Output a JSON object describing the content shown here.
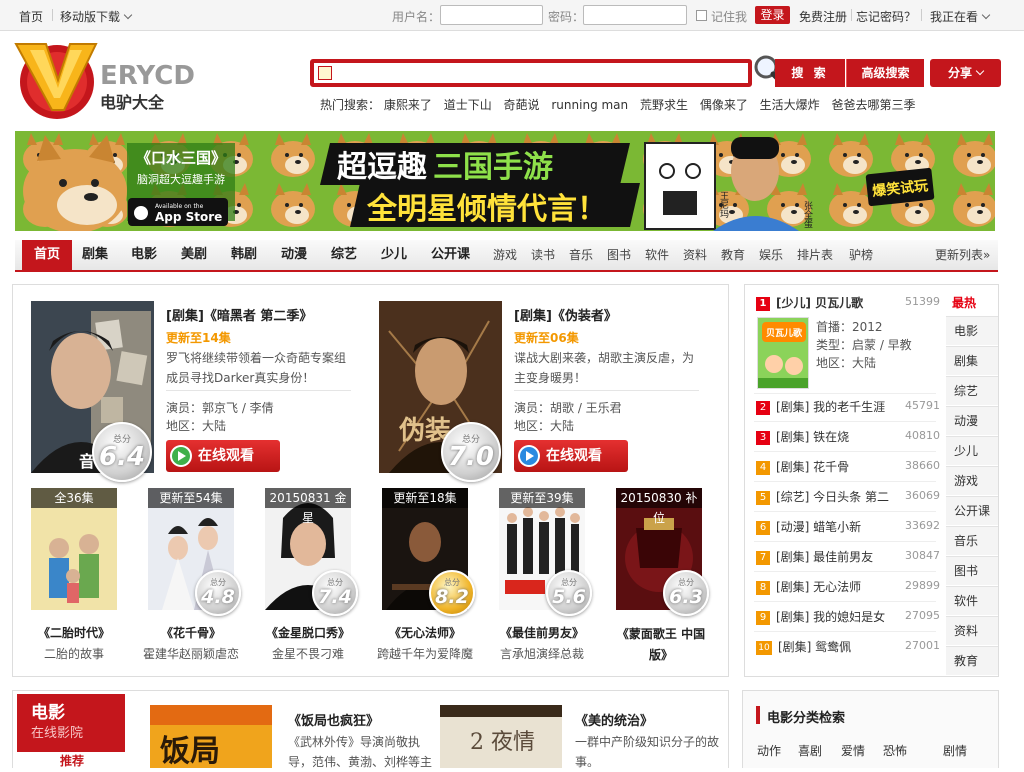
{
  "topbar": {
    "home": "首页",
    "mobile": "移动版下载",
    "user_label": "用户名：",
    "pwd_label": "密码：",
    "remember": "记住我",
    "login": "登录",
    "register": "免费注册",
    "forgot": "忘记密码？",
    "watching": "我正在看"
  },
  "logo": {
    "brand": "ERYCD",
    "cn": "电驴大全",
    "v": "V"
  },
  "search": {
    "button": "搜 索",
    "advanced": "高级搜索",
    "share": "分享",
    "hot_label": "热门搜索：",
    "hot": [
      "康熙来了",
      "道士下山",
      "奇葩说",
      "running man",
      "荒野求生",
      "偶像来了",
      "生活大爆炸",
      "爸爸去哪第三季"
    ]
  },
  "banner": {
    "game": "《口水三国》",
    "tagline": "脑洞超大逗趣手游",
    "appstore_small": "Available on the",
    "appstore": "App Store",
    "headline1a": "超逗趣",
    "headline1b": "三国手游",
    "headline2": "全明星倾情代言！",
    "name1": "王尼玛",
    "name2": "张全蛋",
    "cta": "爆笑试玩"
  },
  "nav": {
    "main": [
      "首页",
      "剧集",
      "电影",
      "美剧",
      "韩剧",
      "动漫",
      "综艺",
      "少儿",
      "公开课"
    ],
    "sub": [
      "游戏",
      "读书",
      "音乐",
      "图书",
      "软件",
      "资料",
      "教育",
      "娱乐",
      "排片表",
      "驴榜"
    ],
    "more": "更新列表»"
  },
  "featured": [
    {
      "title": "[剧集]《暗黑者 第二季》",
      "update": "更新至14集",
      "desc": "罗飞将继续带领着一众奇葩专案组成员寻找Darker真实身份！",
      "actors": "演员：郭京飞 / 李倩",
      "region": "地区：大陆",
      "score": "6.4",
      "watch": "在线观看",
      "poster_text": "音"
    },
    {
      "title": "[剧集]《伪装者》",
      "update": "更新至06集",
      "desc": "谍战大剧来袭，胡歌主演反虐，为主变身暖男！",
      "actors": "演员：胡歌 / 王乐君",
      "region": "地区：大陆",
      "score": "7.0",
      "watch": "在线观看",
      "poster_text": "伪装"
    }
  ],
  "score_label": "总分",
  "thumbs": [
    {
      "tag": "全36集",
      "title": "《二胎时代》",
      "sub": "二胎的故事",
      "score": ""
    },
    {
      "tag": "更新至54集",
      "title": "《花千骨》",
      "sub": "霍建华赵丽颖虐恋",
      "score": "4.8"
    },
    {
      "tag": "20150831 金星",
      "title": "《金星脱口秀》",
      "sub": "金星不畏刁难",
      "score": "7.4"
    },
    {
      "tag": "更新至18集",
      "title": "《无心法师》",
      "sub": "跨越千年为爱降魔",
      "score": "8.2"
    },
    {
      "tag": "更新至39集",
      "title": "《最佳前男友》",
      "sub": "言承旭演绎总裁",
      "score": "5.6"
    },
    {
      "tag": "20150830 补位",
      "title": "《蒙面歌王 中国版》",
      "sub": "",
      "score": "6.3"
    }
  ],
  "rank": {
    "title": "[少儿] 贝瓦儿歌",
    "hot_tab": "最热",
    "top_count": "51399",
    "info": [
      "首播：2012",
      "类型：启蒙 / 早教",
      "地区：大陆"
    ],
    "items": [
      {
        "n": "2",
        "t": "[剧集] 我的老千生涯",
        "c": "45791"
      },
      {
        "n": "3",
        "t": "[剧集] 铁在烧",
        "c": "40810"
      },
      {
        "n": "4",
        "t": "[剧集] 花千骨",
        "c": "38660"
      },
      {
        "n": "5",
        "t": "[综艺] 今日头条 第二",
        "c": "36069"
      },
      {
        "n": "6",
        "t": "[动漫] 蜡笔小新",
        "c": "33692"
      },
      {
        "n": "7",
        "t": "[剧集] 最佳前男友",
        "c": "30847"
      },
      {
        "n": "8",
        "t": "[剧集] 无心法师",
        "c": "29899"
      },
      {
        "n": "9",
        "t": "[剧集] 我的媳妇是女",
        "c": "27095"
      },
      {
        "n": "10",
        "t": "[剧集] 鸳鸯佩",
        "c": "27001"
      }
    ],
    "categories": [
      "电影",
      "剧集",
      "综艺",
      "动漫",
      "少儿",
      "游戏",
      "公开课",
      "音乐",
      "图书",
      "软件",
      "资料",
      "教育"
    ],
    "thumb_text": "贝瓦儿歌"
  },
  "movie": {
    "tag": "电影",
    "tag_sub": "在线影院",
    "tag_btn": "推荐",
    "items": [
      {
        "title": "《饭局也疯狂》",
        "desc": "《武林外传》导演尚敬执导，范伟、黄渤、刘桦等主",
        "poster": "饭局"
      },
      {
        "title": "《美的统治》",
        "desc": "一群中产阶级知识分子的故事。",
        "poster": "2 夜情"
      }
    ]
  },
  "filter": {
    "title": "电影分类检索",
    "genres": [
      "动作",
      "喜剧",
      "爱情",
      "恐怖",
      "剧情"
    ]
  },
  "colors": {
    "brand_red": "#c4161c",
    "update_orange": "#f39800",
    "rank_red": "#e60012",
    "rank_orange": "#f39800"
  }
}
